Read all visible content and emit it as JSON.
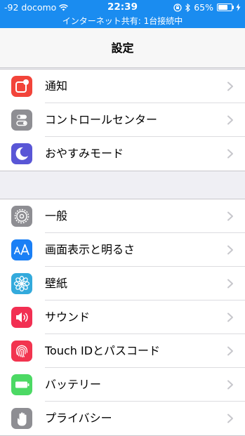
{
  "status_bar": {
    "carrier": "-92 docomo",
    "time": "22:39",
    "battery": "65%",
    "battery_level": 0.65,
    "hotspot": "インターネット共有: 1台接続中",
    "background_color": "#1a8cf0"
  },
  "nav": {
    "title": "設定"
  },
  "groups": [
    {
      "items": [
        {
          "label": "通知",
          "icon": "notifications-icon",
          "color": "#f2443a"
        },
        {
          "label": "コントロールセンター",
          "icon": "control-center-icon",
          "color": "#8e8e93"
        },
        {
          "label": "おやすみモード",
          "icon": "do-not-disturb-icon",
          "color": "#5956d6"
        }
      ]
    },
    {
      "items": [
        {
          "label": "一般",
          "icon": "gear-icon",
          "color": "#8e8e93"
        },
        {
          "label": "画面表示と明るさ",
          "icon": "display-brightness-icon",
          "color": "#1a7ff5"
        },
        {
          "label": "壁紙",
          "icon": "wallpaper-icon",
          "color": "#33aadc"
        },
        {
          "label": "サウンド",
          "icon": "sound-icon",
          "color": "#f22f52"
        },
        {
          "label": "Touch IDとパスコード",
          "icon": "fingerprint-icon",
          "color": "#f2344f"
        },
        {
          "label": "バッテリー",
          "icon": "battery-icon",
          "color": "#4cd964"
        },
        {
          "label": "プライバシー",
          "icon": "privacy-hand-icon",
          "color": "#8e8e93"
        }
      ]
    }
  ]
}
